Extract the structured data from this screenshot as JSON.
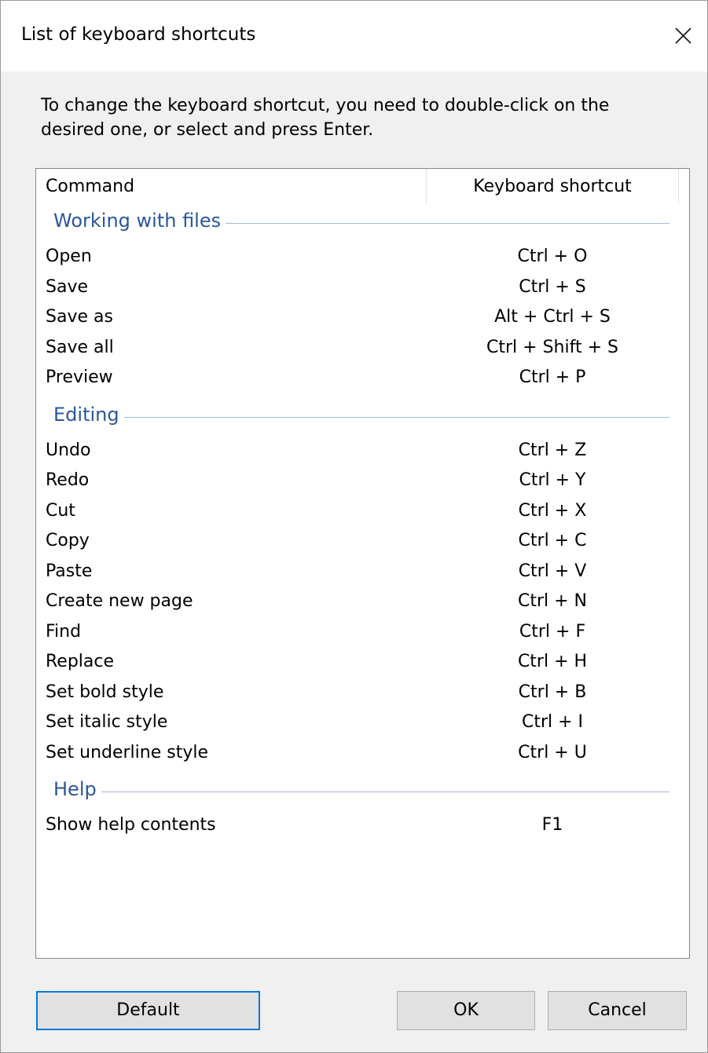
{
  "window": {
    "title": "List of keyboard shortcuts",
    "close_glyph": "close-icon"
  },
  "instructions": "To change the keyboard shortcut, you need to double-click on the desired one, or select and press Enter.",
  "list": {
    "columns": [
      "Command",
      "Keyboard shortcut"
    ],
    "groups": [
      {
        "name": "Working with files",
        "items": [
          {
            "command": "Open",
            "shortcut": "Ctrl + O"
          },
          {
            "command": "Save",
            "shortcut": "Ctrl + S"
          },
          {
            "command": "Save as",
            "shortcut": "Alt + Ctrl + S"
          },
          {
            "command": "Save all",
            "shortcut": "Ctrl + Shift + S"
          },
          {
            "command": "Preview",
            "shortcut": "Ctrl + P"
          }
        ]
      },
      {
        "name": "Editing",
        "items": [
          {
            "command": "Undo",
            "shortcut": "Ctrl + Z"
          },
          {
            "command": "Redo",
            "shortcut": "Ctrl + Y"
          },
          {
            "command": "Cut",
            "shortcut": "Ctrl + X"
          },
          {
            "command": "Copy",
            "shortcut": "Ctrl + C"
          },
          {
            "command": "Paste",
            "shortcut": "Ctrl + V"
          },
          {
            "command": "Create new page",
            "shortcut": "Ctrl + N"
          },
          {
            "command": "Find",
            "shortcut": "Ctrl + F"
          },
          {
            "command": "Replace",
            "shortcut": "Ctrl + H"
          },
          {
            "command": "Set bold style",
            "shortcut": "Ctrl + B"
          },
          {
            "command": "Set italic style",
            "shortcut": "Ctrl + I"
          },
          {
            "command": "Set underline style",
            "shortcut": "Ctrl + U"
          }
        ]
      },
      {
        "name": "Help",
        "items": [
          {
            "command": "Show help contents",
            "shortcut": "F1"
          }
        ]
      }
    ]
  },
  "buttons": {
    "default": "Default",
    "ok": "OK",
    "cancel": "Cancel"
  },
  "colors": {
    "group_header": "#2b579a",
    "focus_border": "#0078d7",
    "button_face": "#e1e1e1"
  }
}
